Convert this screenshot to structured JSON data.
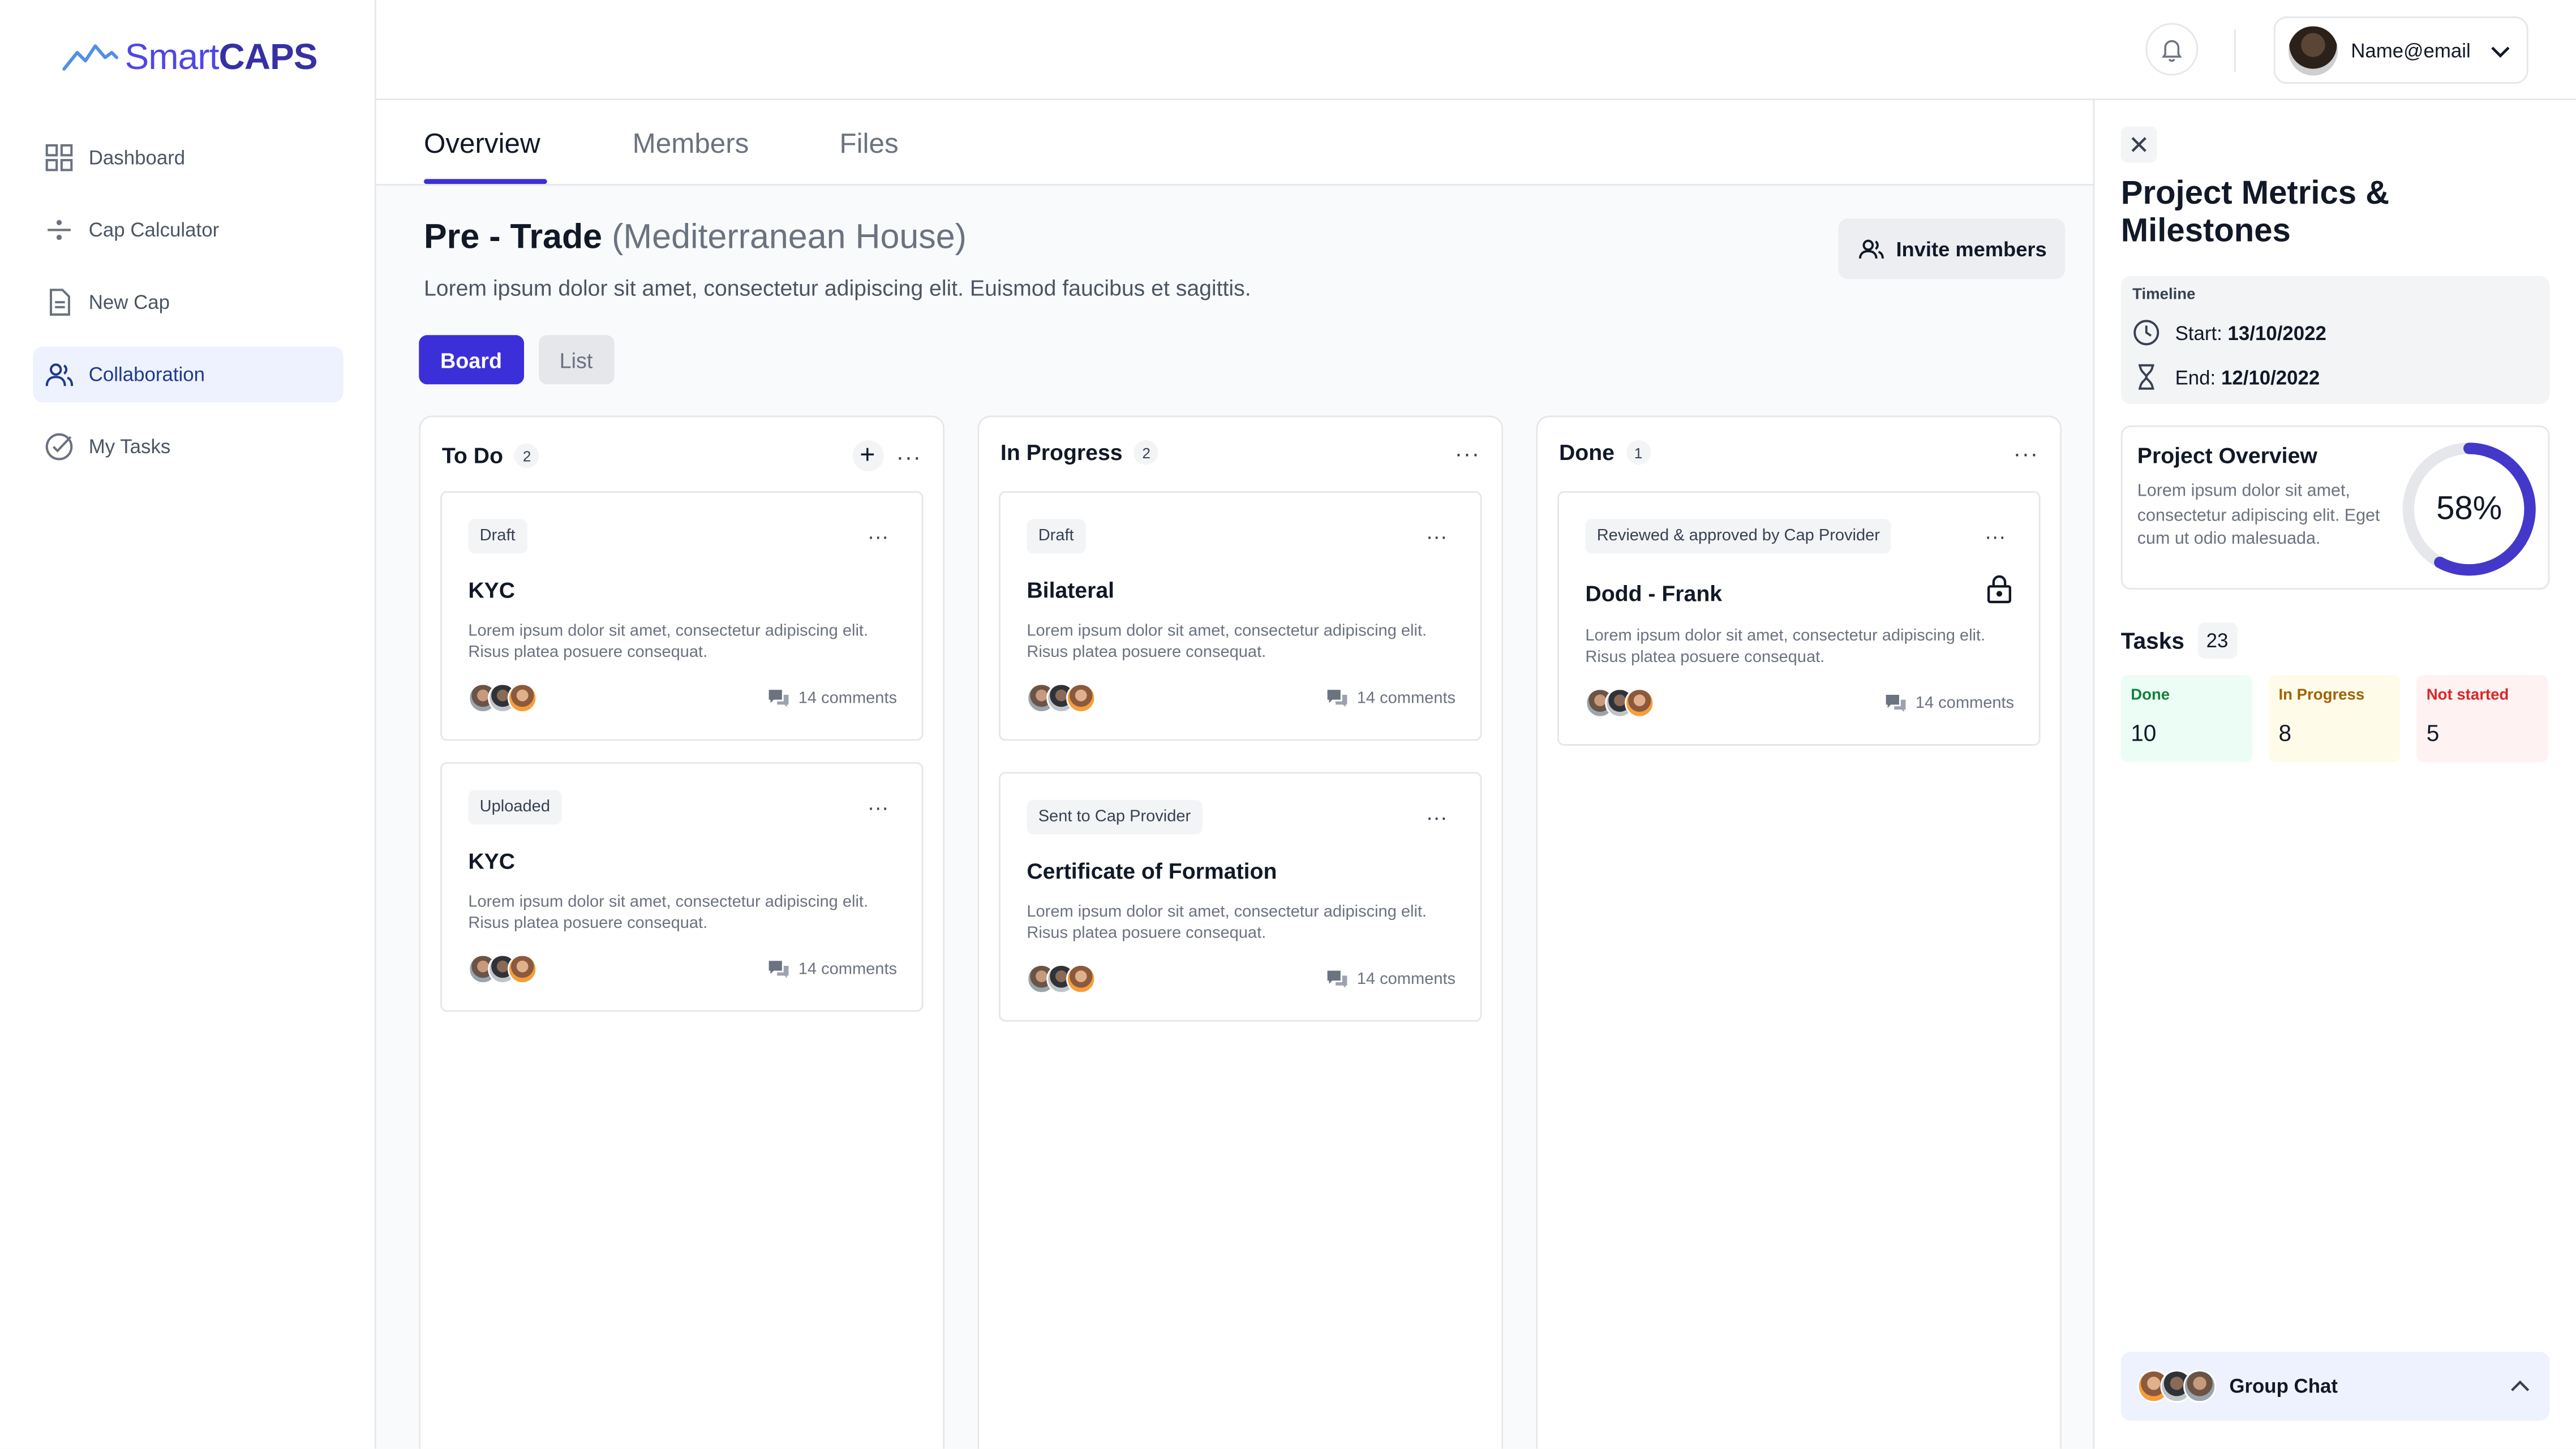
{
  "app": {
    "logo_prefix": "Smart",
    "logo_suffix": "CAPS"
  },
  "sidebar": {
    "items": [
      {
        "label": "Dashboard",
        "icon": "grid-icon"
      },
      {
        "label": "Cap Calculator",
        "icon": "calculator-icon"
      },
      {
        "label": "New Cap",
        "icon": "document-icon"
      },
      {
        "label": "Collaboration",
        "icon": "users-icon",
        "active": true
      },
      {
        "label": "My Tasks",
        "icon": "check-circle-icon"
      }
    ]
  },
  "header": {
    "user_email": "Name@email"
  },
  "tabs": [
    {
      "label": "Overview",
      "active": true
    },
    {
      "label": "Members"
    },
    {
      "label": "Files"
    }
  ],
  "project": {
    "title": "Pre - Trade",
    "subtitle": "(Mediterranean House)",
    "description": "Lorem ipsum dolor sit amet, consectetur adipiscing elit. Euismod faucibus et sagittis.",
    "invite_label": "Invite members"
  },
  "view_toggle": {
    "board": "Board",
    "list": "List"
  },
  "columns": [
    {
      "title": "To Do",
      "count": "2",
      "cards": [
        {
          "tag": "Draft",
          "title": "KYC",
          "description": "Lorem ipsum dolor sit amet, consectetur adipiscing elit. Risus platea posuere consequat.",
          "comments": "14 comments"
        },
        {
          "tag": "Uploaded",
          "title": "KYC",
          "description": "Lorem ipsum dolor sit amet, consectetur adipiscing elit. Risus platea posuere consequat.",
          "comments": "14 comments"
        }
      ]
    },
    {
      "title": "In Progress",
      "count": "2",
      "cards": [
        {
          "tag": "Draft",
          "title": "Bilateral",
          "description": "Lorem ipsum dolor sit amet, consectetur adipiscing elit. Risus platea posuere consequat.",
          "comments": "14 comments"
        },
        {
          "tag": "Sent to Cap Provider",
          "title": "Certificate of Formation",
          "description": "Lorem ipsum dolor sit amet, consectetur adipiscing elit. Risus platea posuere consequat.",
          "comments": "14 comments"
        }
      ]
    },
    {
      "title": "Done",
      "count": "1",
      "cards": [
        {
          "tag": "Reviewed & approved by Cap Provider",
          "title": "Dodd - Frank",
          "description": "Lorem ipsum dolor sit amet, consectetur adipiscing elit. Risus platea posuere consequat.",
          "comments": "14 comments",
          "icon": "lock-icon"
        }
      ]
    }
  ],
  "panel": {
    "title": "Project Metrics & Milestones",
    "timeline_label": "Timeline",
    "start_label": "Start:",
    "start_value": "13/10/2022",
    "end_label": "End:",
    "end_value": "12/10/2022",
    "overview_title": "Project Overview",
    "overview_desc": "Lorem ipsum dolor sit amet, consectetur adipiscing elit. Eget cum ut odio malesuada.",
    "progress_pct": 58,
    "progress_label": "58%",
    "tasks_title": "Tasks",
    "tasks_count": "23",
    "stats": [
      {
        "label": "Done",
        "value": "10"
      },
      {
        "label": "In Progress",
        "value": "8"
      },
      {
        "label": "Not started",
        "value": "5"
      }
    ],
    "group_chat_label": "Group Chat"
  },
  "colors": {
    "accent": "#3b2fd9",
    "active_nav_bg": "#eef2ff"
  }
}
